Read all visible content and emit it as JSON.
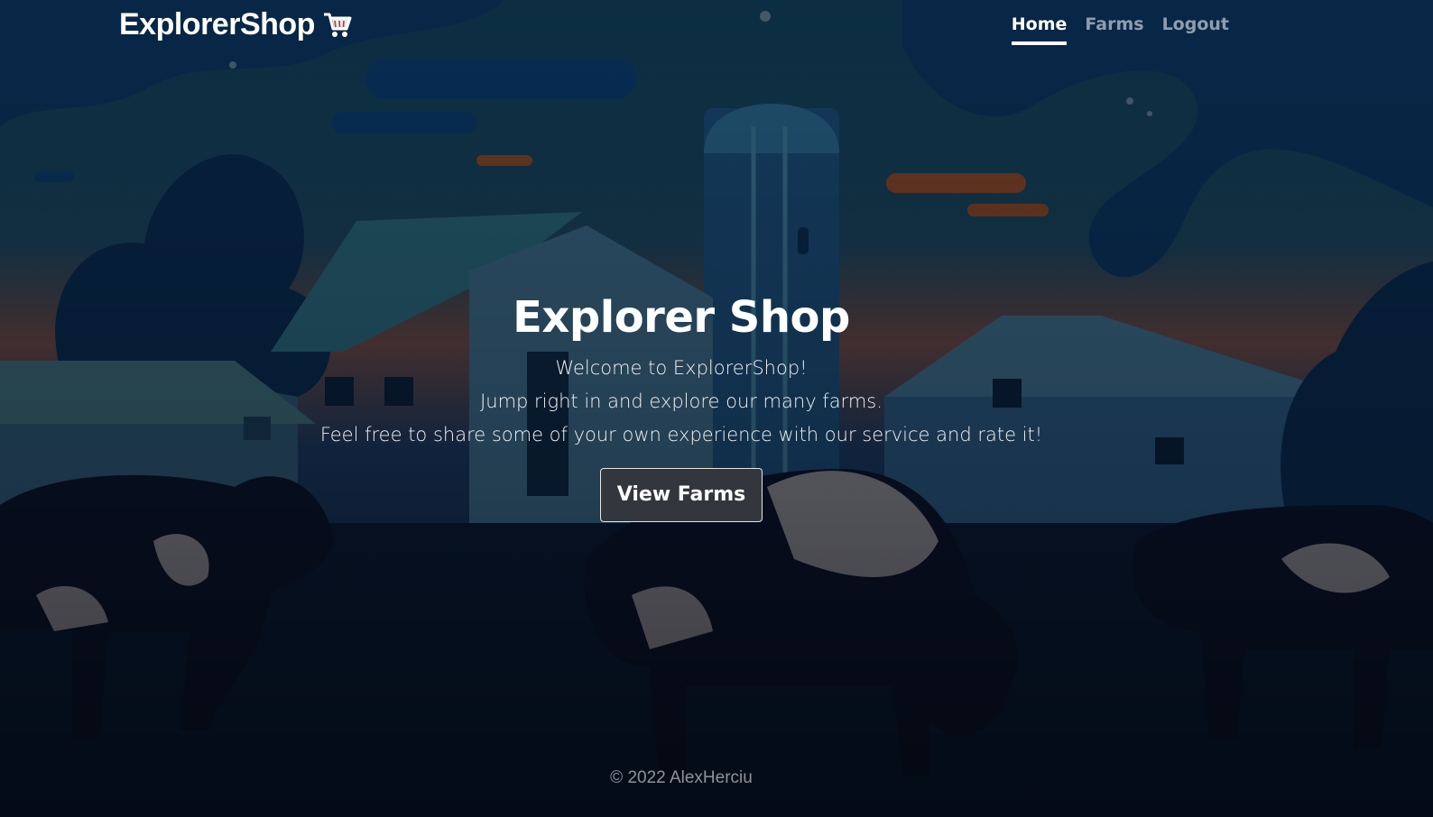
{
  "header": {
    "brand": "ExplorerShop",
    "brand_icon": "shopping-cart-icon",
    "nav": [
      {
        "label": "Home",
        "active": true
      },
      {
        "label": "Farms",
        "active": false
      },
      {
        "label": "Logout",
        "active": false
      }
    ]
  },
  "hero": {
    "title": "Explorer Shop",
    "lines": [
      "Welcome to ExplorerShop!",
      "Jump right in and explore our many farms.",
      "Feel free to share some of your own experience with our service and rate it!"
    ],
    "button_label": "View Farms"
  },
  "footer": {
    "text": "© 2022 AlexHerciu"
  },
  "colors": {
    "sky": "#0e2d52",
    "accent": "#ffffff",
    "button_bg": "#33373d"
  }
}
